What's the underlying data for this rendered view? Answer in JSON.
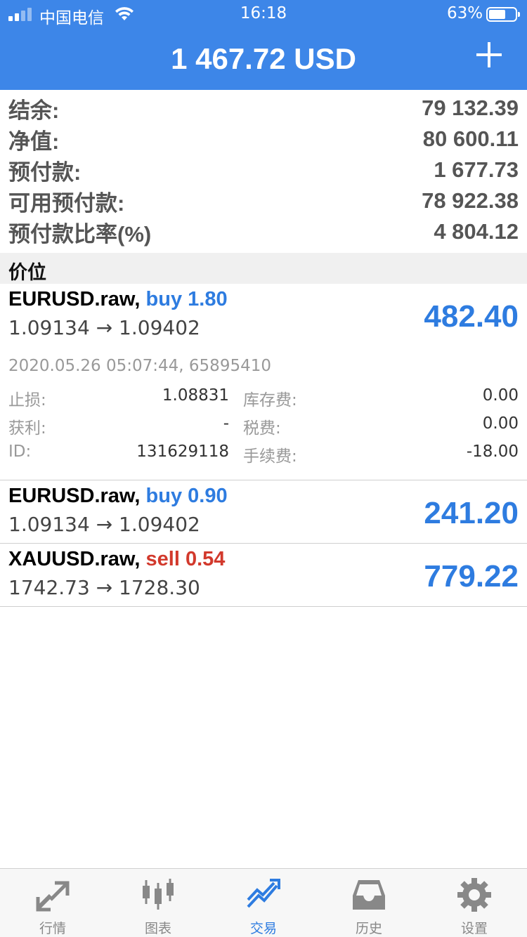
{
  "status_bar": {
    "carrier": "中国电信",
    "time": "16:18",
    "battery": "63%",
    "battery_level": 0.63
  },
  "header": {
    "title": "1 467.72 USD",
    "add_icon": "plus-icon"
  },
  "summary": [
    {
      "label": "结余:",
      "value": "79 132.39"
    },
    {
      "label": "净值:",
      "value": "80 600.11"
    },
    {
      "label": "预付款:",
      "value": "1 677.73"
    },
    {
      "label": "可用预付款:",
      "value": "78 922.38"
    },
    {
      "label": "预付款比率(%)",
      "value": "4 804.12"
    }
  ],
  "section_title": "价位",
  "positions": [
    {
      "symbol": "EURUSD.raw,",
      "direction": "buy",
      "volume": "buy 1.80",
      "prices": "1.09134 → 1.09402",
      "profit": "482.40",
      "expanded": {
        "timestamp": "2020.05.26 05:07:44, 65895410",
        "rows": [
          {
            "k1": "止损:",
            "v1": "1.08831",
            "k2": "库存费:",
            "v2": "0.00"
          },
          {
            "k1": "获利:",
            "v1": "-",
            "k2": "税费:",
            "v2": "0.00"
          },
          {
            "k1": "ID:",
            "v1": "131629118",
            "k2": "手续费:",
            "v2": "-18.00"
          }
        ]
      }
    },
    {
      "symbol": "EURUSD.raw,",
      "direction": "buy",
      "volume": "buy 0.90",
      "prices": "1.09134 → 1.09402",
      "profit": "241.20"
    },
    {
      "symbol": "XAUUSD.raw,",
      "direction": "sell",
      "volume": "sell 0.54",
      "prices": "1742.73 → 1728.30",
      "profit": "779.22"
    }
  ],
  "tabs": [
    {
      "label": "行情",
      "icon": "quotes-arrows-icon",
      "active": false
    },
    {
      "label": "图表",
      "icon": "candlestick-chart-icon",
      "active": false
    },
    {
      "label": "交易",
      "icon": "trade-trend-icon",
      "active": true
    },
    {
      "label": "历史",
      "icon": "history-inbox-icon",
      "active": false
    },
    {
      "label": "设置",
      "icon": "gear-icon",
      "active": false
    }
  ],
  "colors": {
    "header_bg": "#3d86e8",
    "buy": "#2e7ce0",
    "sell": "#d2392c",
    "profit": "#2e7ce0"
  }
}
